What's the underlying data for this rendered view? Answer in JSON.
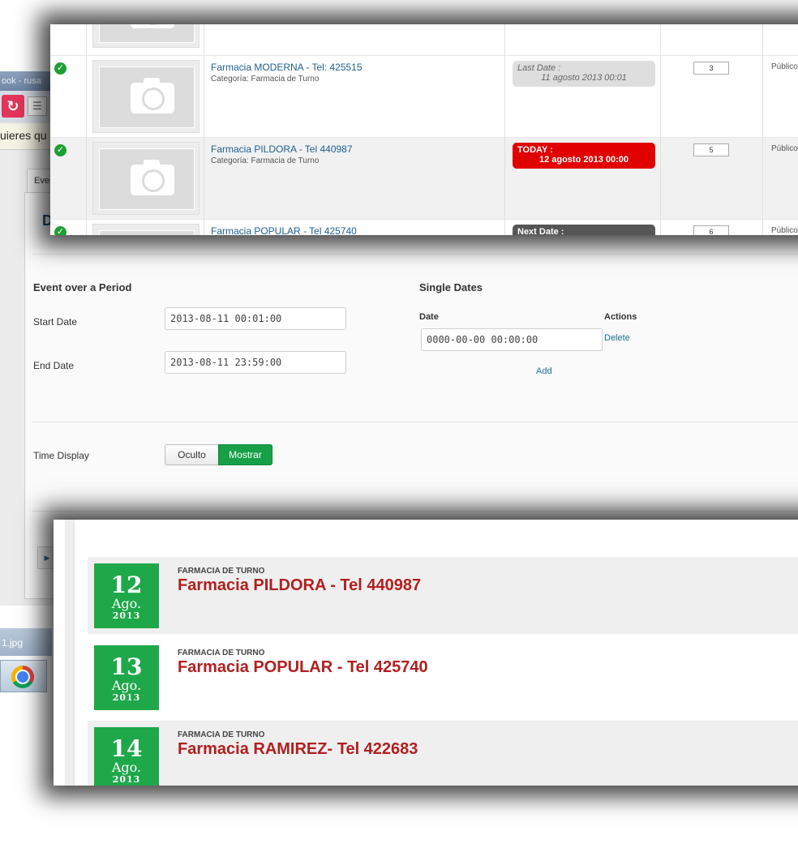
{
  "browser": {
    "window_title": "ook - rusa",
    "infobar_text": "uieres qu",
    "tab_label": "Even",
    "heading_letter": "D",
    "taskbar_file": "1.jpg"
  },
  "event_list": {
    "rows": [
      {
        "title": "Farmacia MODERNA - Tel: 425515",
        "category": "Categoría: Farmacia de Turno",
        "date_label": "Last Date :",
        "date_value": "11 agosto 2013 00:01",
        "date_style": "last",
        "order": "3",
        "access": "Público"
      },
      {
        "title": "Farmacia PILDORA - Tel 440987",
        "category": "Categoría: Farmacia de Turno",
        "date_label": "TODAY :",
        "date_value": "12 agosto 2013 00:00",
        "date_style": "today",
        "order": "5",
        "access": "Público"
      },
      {
        "title": "Farmacia POPULAR - Tel 425740",
        "category": "",
        "date_label": "Next Date :",
        "date_value": "",
        "date_style": "next",
        "order": "6",
        "access": "Público"
      }
    ]
  },
  "form": {
    "period_title": "Event over a Period",
    "start_label": "Start Date",
    "start_value": "2013-08-11 00:01:00",
    "end_label": "End Date",
    "end_value": "2013-08-11 23:59:00",
    "single_title": "Single Dates",
    "col_date": "Date",
    "col_actions": "Actions",
    "single_value": "0000-00-00 00:00:00",
    "delete_label": "Delete",
    "add_label": "Add",
    "time_display_label": "Time Display",
    "option_hide": "Oculto",
    "option_show": "Mostrar",
    "selected_option": "Mostrar"
  },
  "calendar": {
    "items": [
      {
        "day": "12",
        "month": "Ago.",
        "year": "2013",
        "category": "FARMACIA DE TURNO",
        "title": "Farmacia PILDORA - Tel 440987"
      },
      {
        "day": "13",
        "month": "Ago.",
        "year": "2013",
        "category": "FARMACIA DE TURNO",
        "title": "Farmacia POPULAR - Tel 425740"
      },
      {
        "day": "14",
        "month": "Ago.",
        "year": "2013",
        "category": "FARMACIA DE TURNO",
        "title": "Farmacia RAMIREZ- Tel 422683"
      }
    ]
  },
  "colors": {
    "accent_green": "#1ea84a",
    "today_red": "#e00000",
    "title_red": "#b21f1f",
    "link_blue": "#1f5f8f"
  },
  "icons": {
    "published": "check-circle-icon",
    "thumbnail": "camera-icon",
    "reload": "reload-icon",
    "document": "document-icon",
    "browser": "chrome-icon"
  }
}
